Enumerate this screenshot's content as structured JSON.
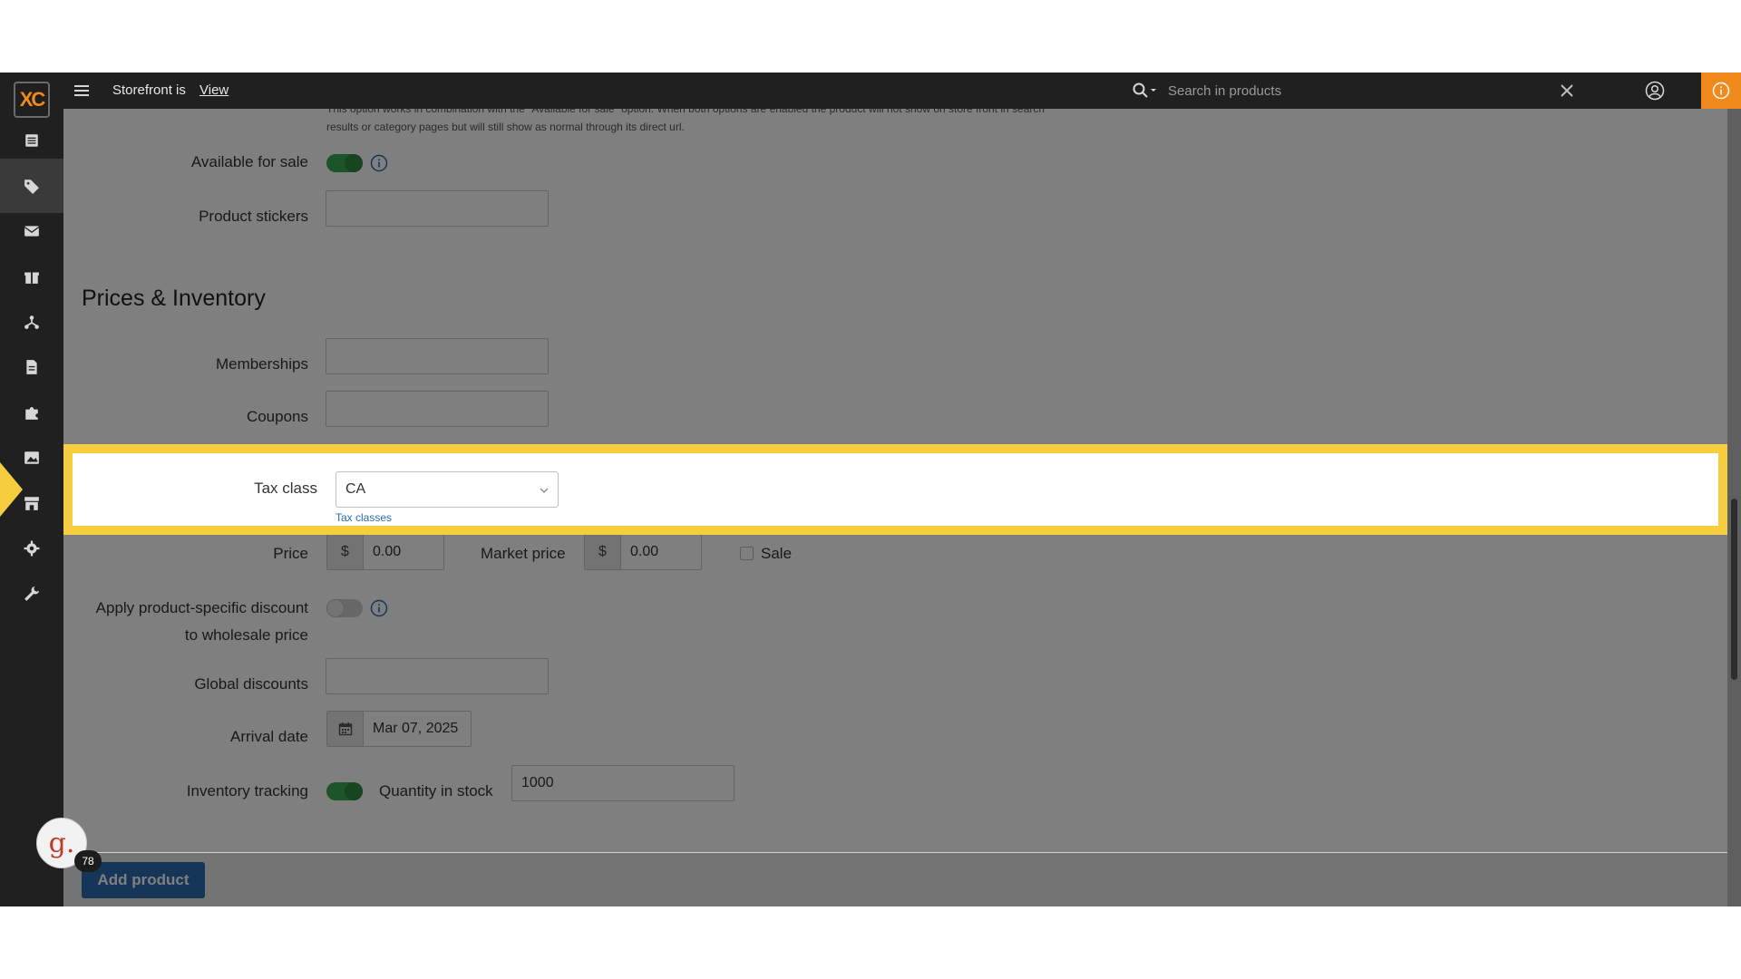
{
  "topbar": {
    "storefront_text": "Storefront is",
    "storefront_link": "View",
    "search_placeholder": "Search in products"
  },
  "sidebar": {
    "logo": "XC",
    "items": [
      {
        "icon": "list-icon"
      },
      {
        "icon": "tag-icon"
      },
      {
        "icon": "envelope-icon"
      },
      {
        "icon": "gift-icon"
      },
      {
        "icon": "network-icon"
      },
      {
        "icon": "document-icon"
      },
      {
        "icon": "puzzle-icon"
      },
      {
        "icon": "image-icon"
      },
      {
        "icon": "store-icon"
      },
      {
        "icon": "gear-icon"
      },
      {
        "icon": "wrench-icon"
      }
    ]
  },
  "form": {
    "note": "This option works in combination with the \"Available for sale\" option. When both options are enabled the product will not show on store front in search results or category pages but will still show as normal through its direct url.",
    "available_for_sale_label": "Available for sale",
    "available_for_sale": true,
    "product_stickers_label": "Product stickers",
    "section_title": "Prices & Inventory",
    "memberships_label": "Memberships",
    "coupons_label": "Coupons",
    "tax_class_label": "Tax class",
    "tax_class_value": "CA",
    "tax_classes_link": "Tax classes",
    "price_label": "Price",
    "price_currency": "$",
    "price_value": "0.00",
    "market_price_label": "Market price",
    "market_price_currency": "$",
    "market_price_value": "0.00",
    "sale_label": "Sale",
    "sale_checked": false,
    "discount_label_line1": "Apply product-specific discount",
    "discount_label_line2": "to wholesale price",
    "discount_enabled": false,
    "global_discounts_label": "Global discounts",
    "arrival_date_label": "Arrival date",
    "arrival_date_value": "Mar 07, 2025",
    "inventory_tracking_label": "Inventory tracking",
    "inventory_tracking": true,
    "quantity_label": "Quantity in stock",
    "quantity_value": "1000"
  },
  "footer": {
    "add_button": "Add product"
  },
  "guide": {
    "avatar_letter": "g.",
    "count": "78"
  },
  "colors": {
    "highlight": "#f5cd3f",
    "accent": "#2a6bb3",
    "toggle_on": "#3aa853",
    "info_badge": "#f08a1c"
  }
}
